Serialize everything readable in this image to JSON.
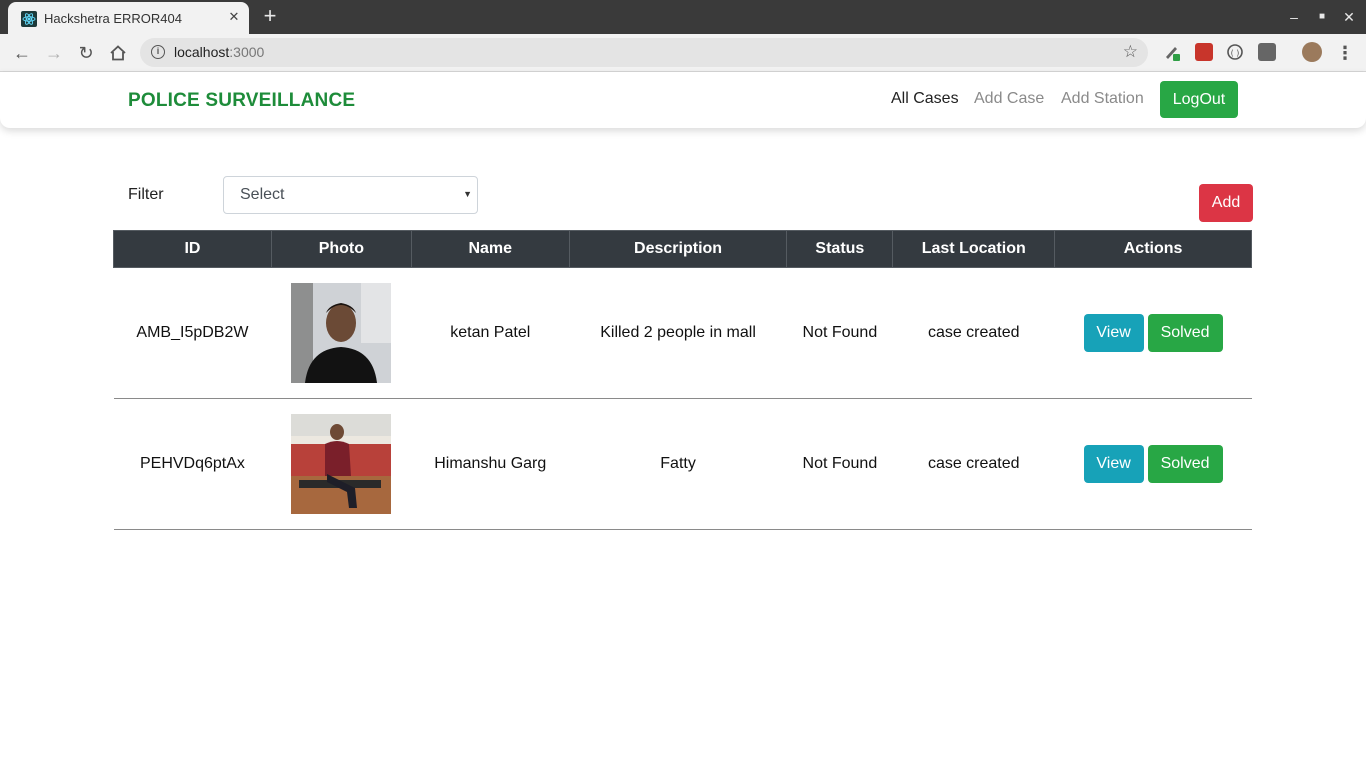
{
  "browser": {
    "tab_title": "Hackshetra ERROR404",
    "url_host": "localhost",
    "url_port": ":3000"
  },
  "nav": {
    "brand": "POLICE SURVEILLANCE",
    "links": [
      "All Cases",
      "Add Case",
      "Add Station"
    ],
    "logout_label": "LogOut"
  },
  "filter": {
    "label": "Filter",
    "selected": "Select"
  },
  "add_label": "Add",
  "table": {
    "headers": [
      "ID",
      "Photo",
      "Name",
      "Description",
      "Status",
      "Last Location",
      "Actions"
    ],
    "rows": [
      {
        "id": "AMB_I5pDB2W",
        "name": "ketan Patel",
        "description": "Killed 2 people in mall",
        "status": "Not Found",
        "last_location": "case created",
        "view_label": "View",
        "solved_label": "Solved"
      },
      {
        "id": "PEHVDq6ptAx",
        "name": "Himanshu Garg",
        "description": "Fatty",
        "status": "Not Found",
        "last_location": "case created",
        "view_label": "View",
        "solved_label": "Solved"
      }
    ]
  },
  "colors": {
    "brand": "#1e8c3a",
    "success": "#28a745",
    "danger": "#dc3545",
    "info": "#17a2b8",
    "table_header": "#343a40",
    "status_text": "#e00000"
  }
}
